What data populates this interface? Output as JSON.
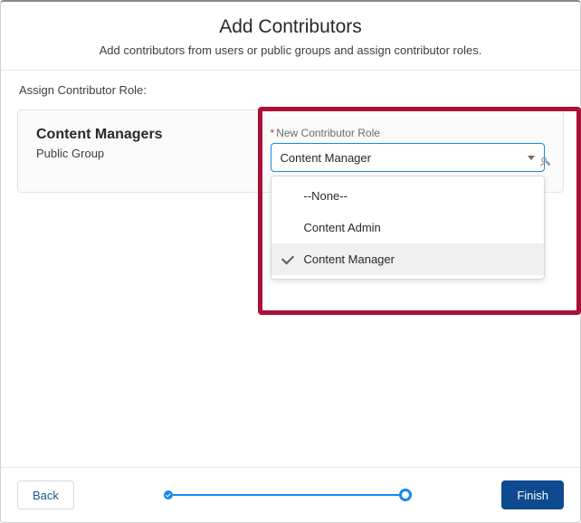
{
  "header": {
    "title": "Add Contributors",
    "subtitle": "Add contributors from users or public groups and assign contributor roles."
  },
  "section": {
    "label": "Assign Contributor Role:"
  },
  "card": {
    "group_name": "Content Managers",
    "group_type": "Public Group",
    "field": {
      "required_mark": "*",
      "label": "New Contributor Role",
      "selected": "Content Manager",
      "options": {
        "none": "--None--",
        "admin": "Content Admin",
        "manager": "Content Manager"
      }
    }
  },
  "footer": {
    "back": "Back",
    "finish": "Finish"
  },
  "colors": {
    "highlight": "#a8103a",
    "primary": "#1589ee",
    "button_primary": "#0d4a8f"
  }
}
